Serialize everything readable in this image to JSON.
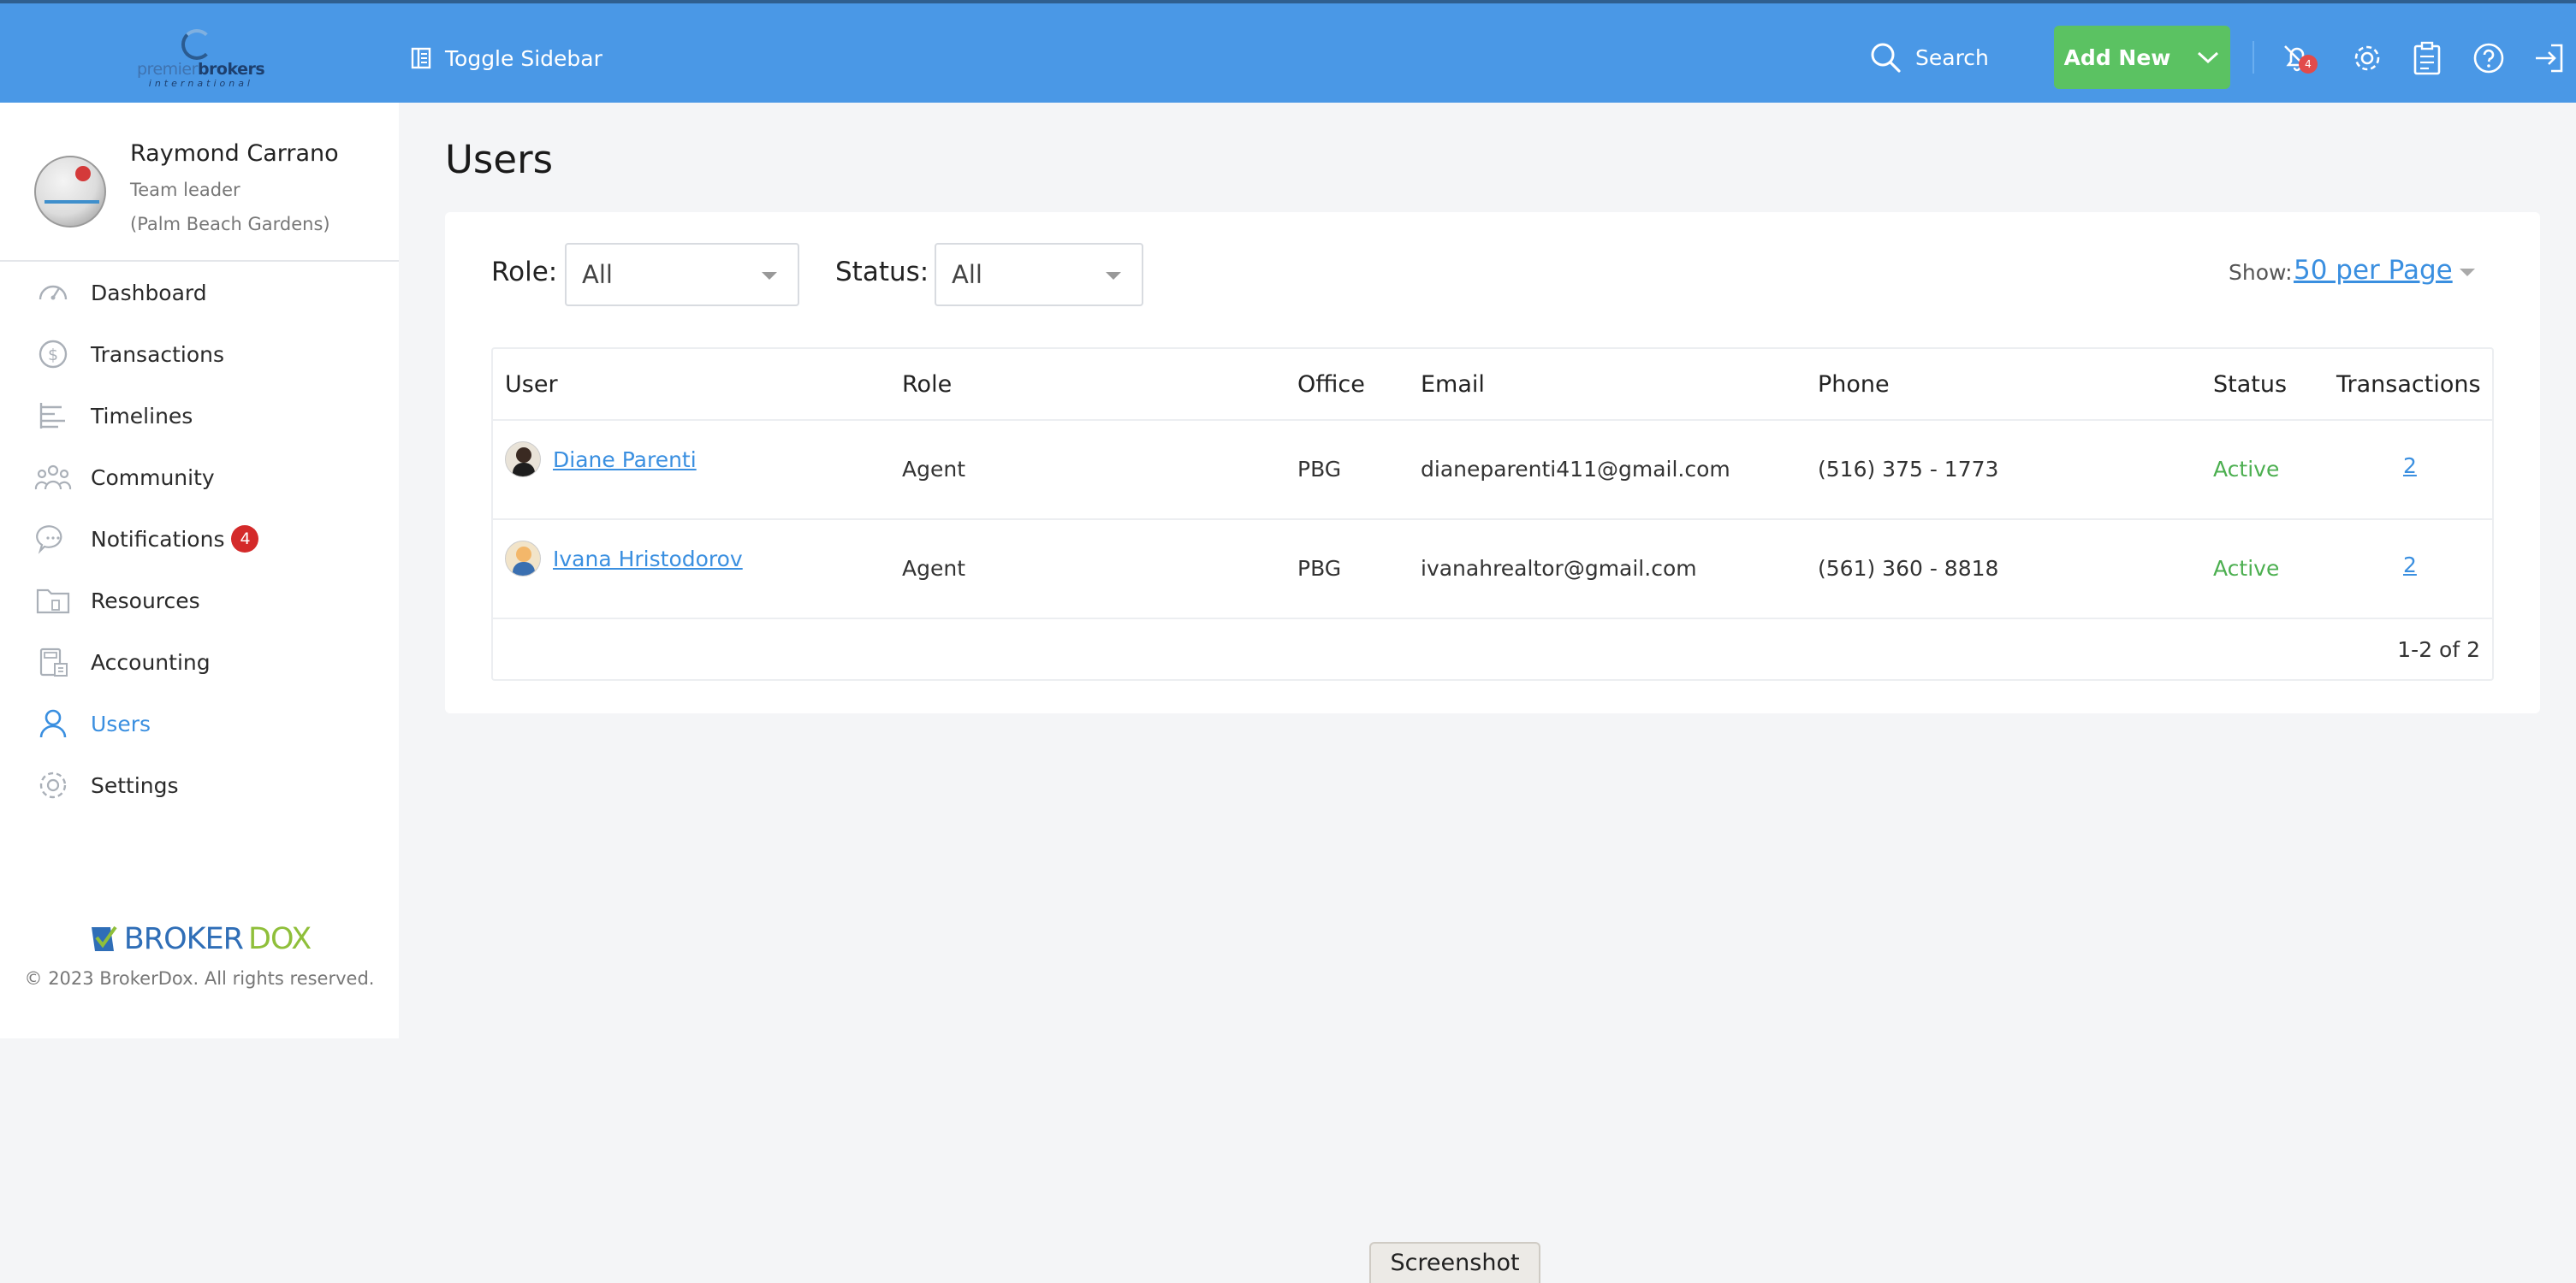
{
  "header": {
    "logo": {
      "word_a": "premier",
      "word_b": "brokers",
      "sub": "international"
    },
    "toggle_sidebar": "Toggle Sidebar",
    "search": "Search",
    "add_new": "Add New",
    "notification_count": "4",
    "icons": [
      "bell-off-icon",
      "gear-icon",
      "clipboard-icon",
      "help-icon",
      "logout-icon"
    ]
  },
  "profile": {
    "name": "Raymond Carrano",
    "role": "Team leader",
    "office": "(Palm Beach Gardens)"
  },
  "sidebar": {
    "items": [
      {
        "label": "Dashboard",
        "icon": "gauge-icon"
      },
      {
        "label": "Transactions",
        "icon": "dollar-circle-icon"
      },
      {
        "label": "Timelines",
        "icon": "timeline-icon"
      },
      {
        "label": "Community",
        "icon": "community-icon"
      },
      {
        "label": "Notifications",
        "icon": "chat-icon",
        "badge": "4"
      },
      {
        "label": "Resources",
        "icon": "folder-icon"
      },
      {
        "label": "Accounting",
        "icon": "calculator-icon"
      },
      {
        "label": "Users",
        "icon": "user-icon",
        "active": true
      },
      {
        "label": "Settings",
        "icon": "gear-icon"
      }
    ],
    "brand_a": "BROKER",
    "brand_b": "DOX",
    "copyright": "© 2023 BrokerDox. All rights reserved."
  },
  "main": {
    "title": "Users",
    "filters": {
      "role_label": "Role:",
      "role_value": "All",
      "status_label": "Status:",
      "status_value": "All",
      "show_label": "Show:",
      "show_value": "50 per Page"
    },
    "table": {
      "columns": [
        "User",
        "Role",
        "Office",
        "Email",
        "Phone",
        "Status",
        "Transactions"
      ],
      "rows": [
        {
          "user": "Diane Parenti",
          "role": "Agent",
          "office": "PBG",
          "email": "dianeparenti411@gmail.com",
          "phone": "(516) 375 - 1773",
          "status": "Active",
          "transactions": "2"
        },
        {
          "user": "Ivana Hristodorov",
          "role": "Agent",
          "office": "PBG",
          "email": "ivanahrealtor@gmail.com",
          "phone": "(561) 360 - 8818",
          "status": "Active",
          "transactions": "2"
        }
      ],
      "pagination": "1-2 of 2"
    }
  },
  "overlay": {
    "screenshot_label": "Screenshot"
  },
  "colors": {
    "header_blue": "#4a98e6",
    "add_green": "#5bc262",
    "link_blue": "#3a8fe0",
    "active_green": "#4caf50",
    "badge_red": "#d42a2a"
  }
}
